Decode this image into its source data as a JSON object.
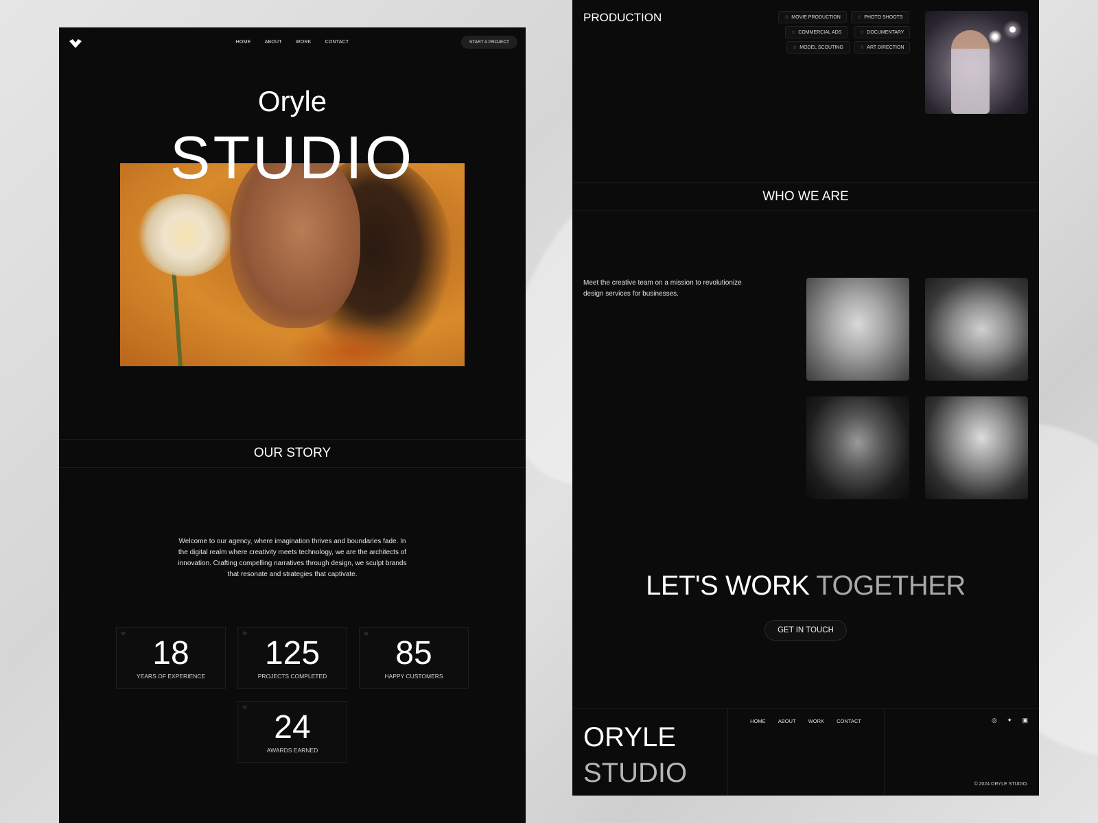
{
  "left_page": {
    "nav": {
      "items": [
        "HOME",
        "ABOUT",
        "WORK",
        "CONTACT"
      ],
      "cta": "START A PROJECT"
    },
    "hero": {
      "title_top": "Oryle",
      "title_bottom": "STUDIO"
    },
    "story": {
      "heading": "OUR STORY",
      "text": "Welcome to our agency, where imagination thrives and boundaries fade. In the digital realm where creativity meets technology, we are the architects of innovation. Crafting compelling narratives through design, we sculpt brands that resonate and strategies that captivate."
    },
    "stats": [
      {
        "value": "18",
        "label": "YEARS OF EXPERIENCE"
      },
      {
        "value": "125",
        "label": "PROJECTS COMPLETED"
      },
      {
        "value": "85",
        "label": "HAPPY CUSTOMERS"
      },
      {
        "value": "24",
        "label": "AWARDS EARNED"
      }
    ]
  },
  "right_page": {
    "production": {
      "heading": "PRODUCTION",
      "tags": [
        "MOVIE PRODUCTION",
        "PHOTO SHOOTS",
        "COMMERCIAL ADS",
        "DOCUMENTARY",
        "MODEL SCOUTING",
        "ART DIRECTION"
      ]
    },
    "who": {
      "heading": "WHO WE ARE",
      "text": "Meet the creative team on a mission to revolutionize design services for businesses."
    },
    "cta": {
      "title_main": "LET'S WORK",
      "title_dim": "TOGETHER",
      "button": "GET IN TOUCH"
    },
    "footer": {
      "brand_line1": "ORYLE",
      "brand_line2": "STUDIO",
      "nav": [
        "HOME",
        "ABOUT",
        "WORK",
        "CONTACT"
      ],
      "social_icons": [
        "instagram-icon",
        "twitter-icon",
        "linkedin-icon"
      ],
      "copyright": "© 2024 ORYLE STUDIO."
    }
  },
  "colors": {
    "panel_bg": "#0b0b0c",
    "text": "#ffffff",
    "muted": "#a9a9a9",
    "hero_orange": "#d88b2c"
  }
}
